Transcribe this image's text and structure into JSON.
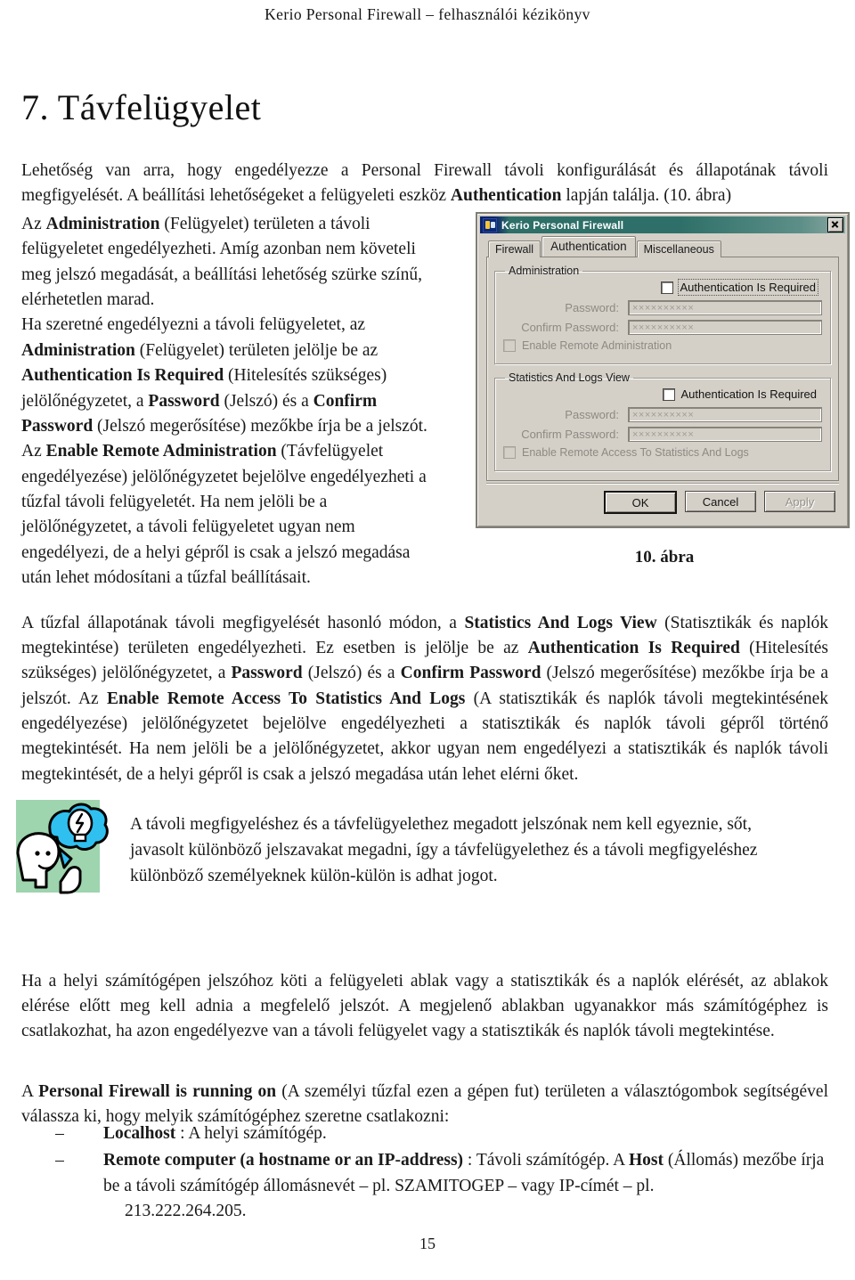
{
  "document": {
    "running_head": "Kerio Personal Firewall  –  felhasználói kézikönyv",
    "chapter_title": "7. Távfelügyelet",
    "page_number": "15"
  },
  "intro": {
    "part1": "Lehetőség van arra, hogy engedélyezze a Personal Firewall távoli konfigurálását és állapotának távoli megfigyelését. A beállítási lehetőségeket a felügyeleti eszköz ",
    "bold1": "Authentication",
    "part2": " lapján találja. (10. ábra)"
  },
  "left_column": {
    "s1": "Az ",
    "b1": "Administration",
    "s2": " (Felügyelet) területen a távoli felügyeletet engedélyezheti. Amíg azonban nem követeli meg jelszó megadását, a beállítási lehetőség szürke színű, elérhetetlen marad.",
    "s3": "Ha szeretné engedélyezni a távoli felügyeletet, az ",
    "b2": "Administration",
    "s4": " (Felügyelet) területen jelölje be az ",
    "b3": "Authentication Is Required",
    "s5": " (Hitelesítés szükséges) jelölőnégyzetet, a ",
    "b4": "Password",
    "s6": " (Jelszó) és a ",
    "b5": "Confirm Password",
    "s7": " (Jelszó megerősítése) mezőkbe írja be a jelszót. Az ",
    "b6": "Enable Remote Administration",
    "s8": " (Távfelügyelet engedélyezése) jelölőnégyzetet bejelölve engedélyezheti a tűzfal távoli felügyeletét. Ha nem jelöli be a jelölőnégyzetet, a távoli felügyeletet ugyan nem engedélyezi, de a helyi gépről is csak a jelszó megadása után lehet módosítani a tűzfal beállításait."
  },
  "figure": {
    "caption": "10. ábra",
    "dialog": {
      "title": "Kerio Personal Firewall",
      "close_label": "×",
      "tabs": [
        {
          "label": "Firewall",
          "active": false
        },
        {
          "label": "Authentication",
          "active": true
        },
        {
          "label": "Miscellaneous",
          "active": false
        }
      ],
      "groups": [
        {
          "title": "Administration",
          "auth_required_label": "Authentication Is Required",
          "auth_required_checked": false,
          "password_label": "Password:",
          "password_value": "××××××××××",
          "confirm_label": "Confirm Password:",
          "confirm_value": "××××××××××",
          "enable_label": "Enable Remote Administration",
          "enable_checked": false
        },
        {
          "title": "Statistics And Logs View",
          "auth_required_label": "Authentication Is Required",
          "auth_required_checked": false,
          "password_label": "Password:",
          "password_value": "××××××××××",
          "confirm_label": "Confirm Password:",
          "confirm_value": "××××××××××",
          "enable_label": "Enable Remote Access To Statistics And Logs",
          "enable_checked": false
        }
      ],
      "buttons": {
        "ok": "OK",
        "cancel": "Cancel",
        "apply": "Apply"
      }
    }
  },
  "stats_paragraph": {
    "s1": "A tűzfal állapotának távoli megfigyelését hasonló módon, a ",
    "b1": "Statistics And Logs View",
    "s2": " (Statisztikák és naplók megtekintése) területen engedélyezheti. Ez esetben is jelölje be az ",
    "b2": "Authentication Is Required",
    "s3": " (Hitelesítés szükséges) jelölőnégyzetet, a ",
    "b3": "Password",
    "s4": " (Jelszó) és a ",
    "b4": "Confirm Password",
    "s5": " (Jelszó megerősítése) mezőkbe írja be a jelszót. Az ",
    "b5": "Enable Remote Access To Statistics And Logs",
    "s6": " (A statisztikák és naplók távoli megtekintésének engedélyezése) jelölőnégyzetet bejelölve engedélyezheti a statisztikák és naplók távoli gépről történő megtekintését. Ha nem jelöli be a jelölőnégyzetet, akkor ugyan nem engedélyezi a statisztikák és naplók távoli megtekintését, de a helyi gépről is csak a jelszó megadása után lehet elérni őket."
  },
  "tip": {
    "icon_name": "lightbulb-thought-bubble-tip-icon",
    "text": "A távoli megfigyeléshez és a távfelügyelethez megadott jelszónak nem kell egyeznie, sőt, javasolt különböző jelszavakat megadni, így a távfelügyelethez és a távoli megfigyeléshez különböző személyeknek külön-külön is adhat jogot."
  },
  "local_paragraph": {
    "text": "Ha a helyi számítógépen jelszóhoz köti a felügyeleti ablak vagy a statisztikák és a naplók elérését, az ablakok elérése előtt meg kell adnia a megfelelő jelszót. A megjelenő ablakban ugyanakkor más számítógéphez is csatlakozhat, ha azon engedélyezve van a távoli felügyelet vagy a statisztikák és naplók távoli megtekintése."
  },
  "running_on_paragraph": {
    "s1": "A ",
    "b1": "Personal Firewall is running on",
    "s2": " (A személyi tűzfal ezen a gépen fut) területen a választógombok segítségével válassza ki, hogy melyik számítógéphez szeretne csatlakozni:"
  },
  "bullets": [
    {
      "dash": "–",
      "bold": "Localhost",
      "rest": " : A helyi számítógép.",
      "cont": ""
    },
    {
      "dash": "–",
      "bold": "Remote computer (a hostname or an IP-address)",
      "rest": " : Távoli számítógép. A ",
      "bold2": "Host",
      "rest2": " (Állomás) mezőbe írja be a távoli számítógép állomásnevét – pl. SZAMITOGEP – vagy IP-címét – pl.",
      "cont": "213.222.264.205."
    }
  ],
  "colors": {
    "titlebar_start": "#0a246a",
    "titlebar_teal": "#2e7069",
    "dialog_face": "#d4d0c8",
    "tip_green": "#9ed4ae",
    "tip_blue": "#2fc0f0"
  }
}
